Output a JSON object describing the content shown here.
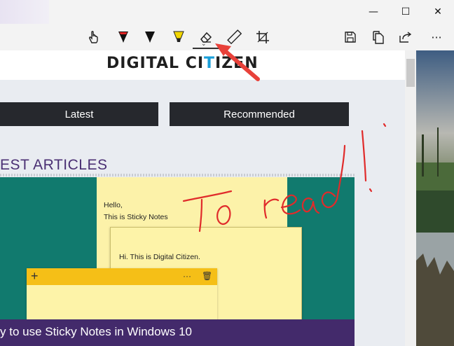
{
  "window": {
    "minimize_glyph": "—",
    "maximize_glyph": "☐",
    "close_glyph": "✕"
  },
  "toolbar": {
    "tools": [
      "touch-writing-icon",
      "ballpoint-pen-icon",
      "pencil-icon",
      "highlighter-icon",
      "eraser-icon",
      "ruler-icon",
      "crop-icon"
    ],
    "actions": [
      "save-icon",
      "copy-icon",
      "share-icon",
      "more-icon"
    ],
    "selected_tool": "eraser-icon",
    "more_glyph": "···",
    "chevron_glyph": "⌄"
  },
  "page": {
    "logo_part1": "DIGITAL CI",
    "logo_part2": "T",
    "logo_part3": "IZEN",
    "nav": [
      "Latest",
      "Recommended"
    ],
    "section_title": "EST ARTICLES",
    "article_caption": "y to use Sticky Notes in Windows 10"
  },
  "notes": {
    "note1_line1": "Hello,",
    "note1_line2": "This is Sticky Notes",
    "note2_text": "Hi. This is Digital Citizen.",
    "note3_add": "+",
    "note3_more": "···",
    "note3_delete": "🗑"
  },
  "annotation": {
    "handwritten_text": "To read!",
    "ink_color": "#e02b2b",
    "arrow_color": "#e8413a"
  },
  "colors": {
    "nav_bg": "#26282d",
    "teal": "#117a6e",
    "purple": "#432a6b",
    "note_yellow": "#fdf3a8",
    "note_bar": "#f5bf17"
  }
}
